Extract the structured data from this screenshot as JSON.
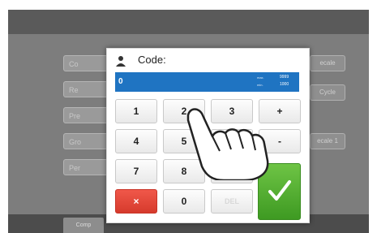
{
  "background": {
    "rows": [
      "Co",
      "Re",
      "Pre",
      "Gro",
      "Per"
    ],
    "buttons": [
      "ecale",
      "Cycle",
      "ecale 1"
    ],
    "bottom_tab": "Comp"
  },
  "dialog": {
    "title": "Code:",
    "user_badge": "user",
    "display": {
      "value": "0",
      "max_label": "max.",
      "max_value": "9999",
      "min_label": "min.",
      "min_value": "1000"
    }
  },
  "keypad": {
    "keys": [
      "1",
      "2",
      "3",
      "+",
      "4",
      "5",
      "6",
      "-",
      "7",
      "8",
      "9"
    ],
    "cancel": "×",
    "zero": "0",
    "delete": "DEL",
    "ok": "check-icon"
  },
  "colors": {
    "display": "#1f74c2",
    "cancel": "#e54a3c",
    "ok": "#52ad30"
  }
}
